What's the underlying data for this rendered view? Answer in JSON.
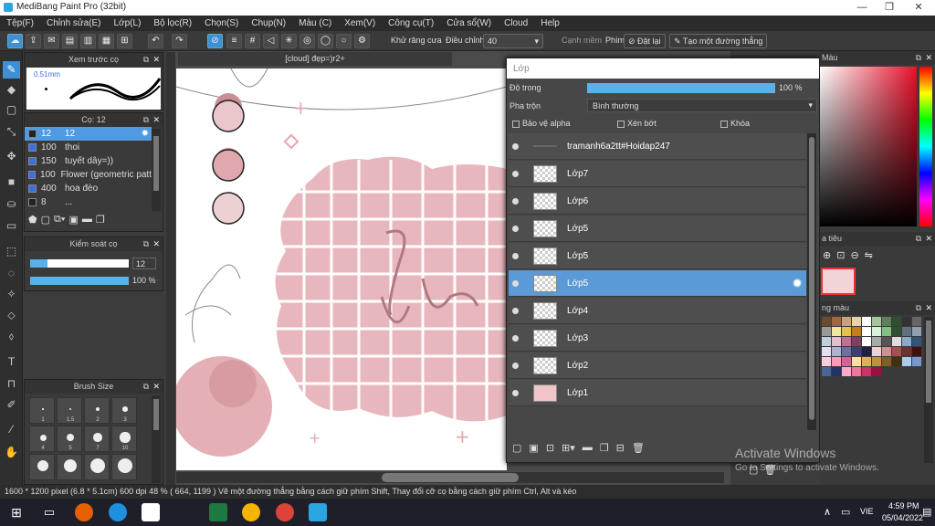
{
  "window": {
    "title": "MediBang Paint Pro (32bit)"
  },
  "menu": [
    "Tệp(F)",
    "Chỉnh sửa(E)",
    "Lớp(L)",
    "Bộ lọc(R)",
    "Chọn(S)",
    "Chụp(N)",
    "Màu (C)",
    "Xem(V)",
    "Công cụ(T)",
    "Cửa sổ(W)",
    "Cloud",
    "Help"
  ],
  "toolbar": {
    "antialias_label": "Khử răng cưa",
    "adjust_label": "Điều chỉnh",
    "adjust_value": "40",
    "edge_label": "Cạnh mềm",
    "key_label": "Phím",
    "reset_label": "Đặt lại",
    "line_label": "Tạo một đường thẳng"
  },
  "preview": {
    "title": "Xem trước cọ",
    "size": "0.51mm"
  },
  "brush_panel": {
    "title": "Cọ: 12",
    "items": [
      {
        "size": "12",
        "name": "12"
      },
      {
        "size": "100",
        "name": "thoi"
      },
      {
        "size": "150",
        "name": "tuyết dây=))"
      },
      {
        "size": "100",
        "name": "Flower (geometric patt"
      },
      {
        "size": "400",
        "name": "hoa đèo"
      },
      {
        "size": "8",
        "name": "..."
      }
    ]
  },
  "brush_control": {
    "title": "Kiểm soát cọ",
    "size": "12",
    "opacity": "100 %",
    "size_fill": 0.18,
    "opacity_fill": 1.0
  },
  "brush_size": {
    "title": "Brush Size",
    "labels": [
      "1",
      "1.5",
      "2",
      "3",
      "4",
      "5",
      "7",
      "10"
    ]
  },
  "document": {
    "tab": "[cloud] đẹp=)r2+"
  },
  "layer_panel": {
    "title": "Lớp",
    "opacity_label": "Độ trong",
    "opacity_value": "100 %",
    "blend_label": "Pha trộn",
    "blend_value": "Bình thường",
    "protect_alpha": "Bảo vệ alpha",
    "clip": "Xén bớt",
    "lock": "Khóa",
    "layers": [
      "tramanh6a2tt#Hoidap247",
      "Lớp7",
      "Lớp6",
      "Lớp5",
      "Lớp5",
      "Lớp5",
      "Lớp4",
      "Lớp3",
      "Lớp2",
      "Lớp1"
    ],
    "selected_index": 5
  },
  "right_panel": {
    "color_title": "Màu",
    "nav_title": "a tiêu",
    "palette_title": "ng màu"
  },
  "watermark": {
    "line1": "Activate Windows",
    "line2": "Go to Settings to activate Windows."
  },
  "status": "1600 * 1200 pixel  (6.8 * 5.1cm)  600 dpi  48 %  ( 664, 1199 )  Vẽ một đường thẳng bằng cách giữ phím Shift, Thay đổi cỡ cọ bằng cách giữ phím Ctrl, Alt và kéo",
  "taskbar": {
    "lang": "VIE",
    "time": "4:59 PM",
    "date": "05/04/2022"
  }
}
